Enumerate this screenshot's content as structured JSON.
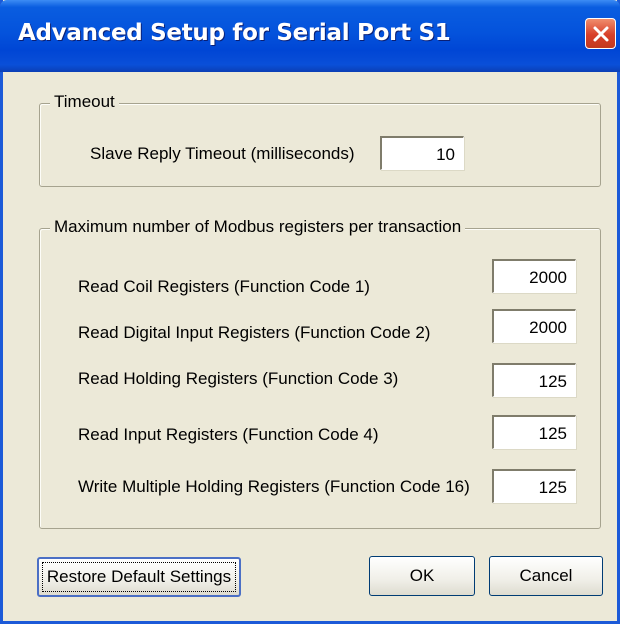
{
  "window": {
    "title": "Advanced Setup for Serial Port S1",
    "close_icon": "close-icon"
  },
  "timeout_group": {
    "legend": "Timeout",
    "slave_reply_label": "Slave Reply Timeout (milliseconds)",
    "slave_reply_value": "10"
  },
  "registers_group": {
    "legend": "Maximum number of Modbus registers per transaction",
    "rows": [
      {
        "label": "Read Coil Registers (Function Code 1)",
        "value": "2000"
      },
      {
        "label": "Read Digital Input Registers (Function Code 2)",
        "value": "2000"
      },
      {
        "label": "Read Holding Registers (Function Code 3)",
        "value": "125"
      },
      {
        "label": "Read Input Registers (Function Code 4)",
        "value": "125"
      },
      {
        "label": "Write Multiple Holding Registers (Function Code 16)",
        "value": "125"
      }
    ]
  },
  "buttons": {
    "restore_label": "Restore Default Settings",
    "ok_label": "OK",
    "cancel_label": "Cancel"
  },
  "colors": {
    "titlebar": "#0453dc",
    "dialog_bg": "#ece9d8",
    "close_button": "#d8402a"
  }
}
